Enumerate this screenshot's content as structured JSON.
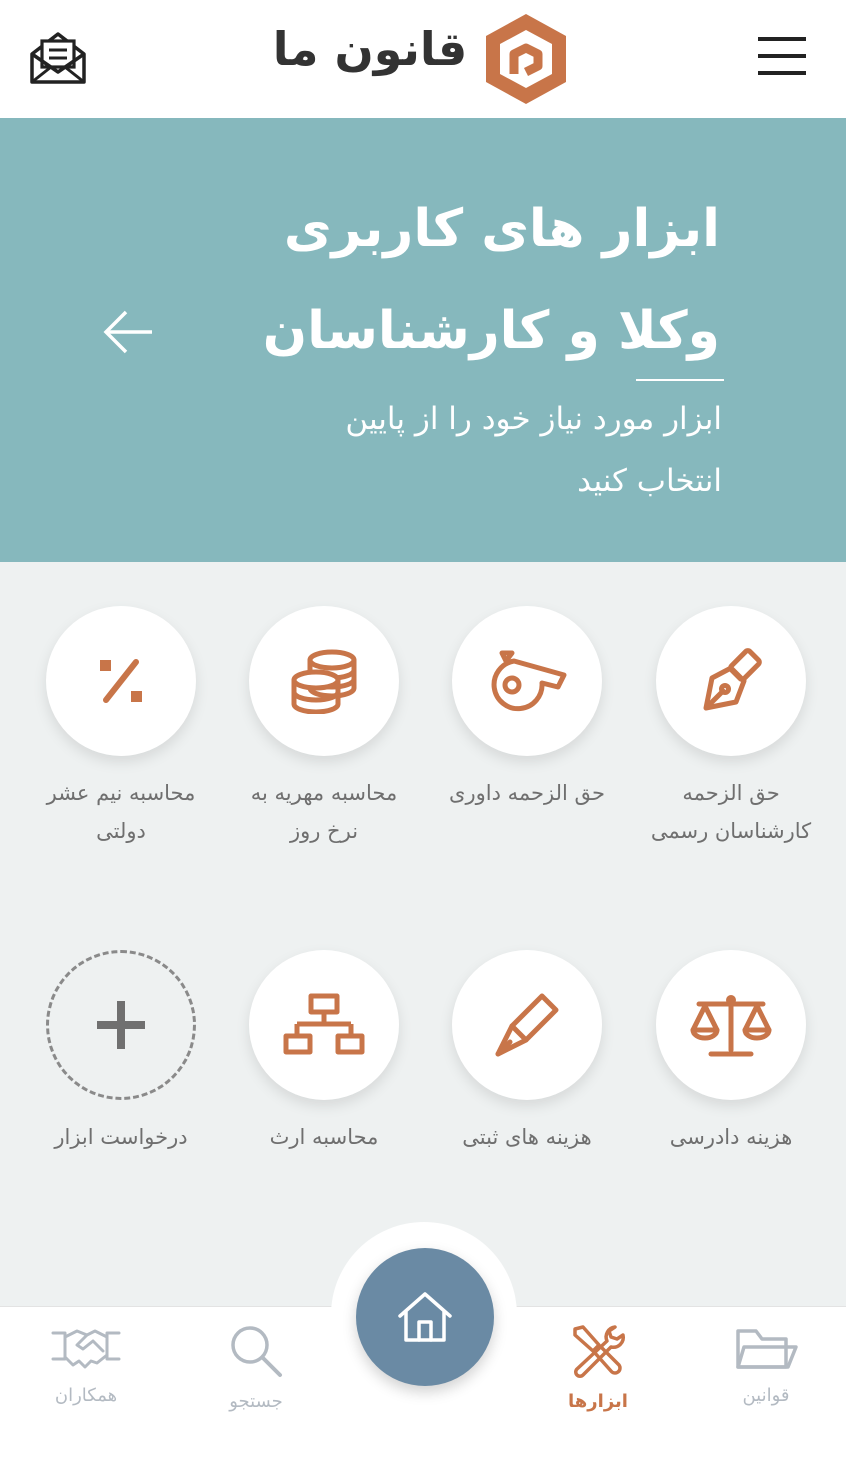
{
  "header": {
    "logo_text": "قانون ما",
    "brand_color": "#c87549"
  },
  "hero": {
    "title_line1": "ابزار های کاربری",
    "title_line2": "وکلا و کارشناسان",
    "subtitle_line1": "ابزار مورد نیاز خود را از پایین",
    "subtitle_line2": "انتخاب کنید",
    "background": "#86b8bd"
  },
  "tools": [
    {
      "line1": "حق الزحمه",
      "line2": "کارشناسان رسمی",
      "icon": "fountain-pen-icon"
    },
    {
      "line1": "حق الزحمه داوری",
      "line2": "",
      "icon": "whistle-icon"
    },
    {
      "line1": "محاسبه مهریه به",
      "line2": "نرخ روز",
      "icon": "coins-icon"
    },
    {
      "line1": "محاسبه نیم عشر",
      "line2": "دولتی",
      "icon": "percent-icon"
    },
    {
      "line1": "هزینه دادرسی",
      "line2": "",
      "icon": "scales-icon"
    },
    {
      "line1": "هزینه های ثبتی",
      "line2": "",
      "icon": "brush-pen-icon"
    },
    {
      "line1": "محاسبه ارث",
      "line2": "",
      "icon": "hierarchy-icon"
    },
    {
      "line1": "درخواست ابزار",
      "line2": "",
      "icon": "plus-icon"
    }
  ],
  "nav": {
    "laws": "قوانین",
    "tools": "ابزارها",
    "search": "جستجو",
    "partners": "همکاران",
    "active": "tools"
  }
}
